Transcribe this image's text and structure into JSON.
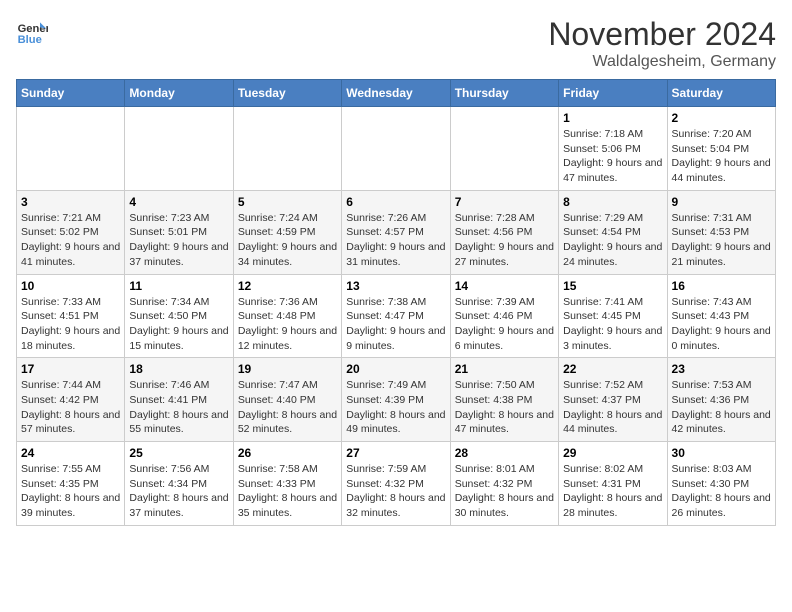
{
  "logo": {
    "line1": "General",
    "line2": "Blue"
  },
  "title": "November 2024",
  "location": "Waldalgesheim, Germany",
  "days_header": [
    "Sunday",
    "Monday",
    "Tuesday",
    "Wednesday",
    "Thursday",
    "Friday",
    "Saturday"
  ],
  "weeks": [
    [
      {
        "day": "",
        "info": ""
      },
      {
        "day": "",
        "info": ""
      },
      {
        "day": "",
        "info": ""
      },
      {
        "day": "",
        "info": ""
      },
      {
        "day": "",
        "info": ""
      },
      {
        "day": "1",
        "info": "Sunrise: 7:18 AM\nSunset: 5:06 PM\nDaylight: 9 hours and 47 minutes."
      },
      {
        "day": "2",
        "info": "Sunrise: 7:20 AM\nSunset: 5:04 PM\nDaylight: 9 hours and 44 minutes."
      }
    ],
    [
      {
        "day": "3",
        "info": "Sunrise: 7:21 AM\nSunset: 5:02 PM\nDaylight: 9 hours and 41 minutes."
      },
      {
        "day": "4",
        "info": "Sunrise: 7:23 AM\nSunset: 5:01 PM\nDaylight: 9 hours and 37 minutes."
      },
      {
        "day": "5",
        "info": "Sunrise: 7:24 AM\nSunset: 4:59 PM\nDaylight: 9 hours and 34 minutes."
      },
      {
        "day": "6",
        "info": "Sunrise: 7:26 AM\nSunset: 4:57 PM\nDaylight: 9 hours and 31 minutes."
      },
      {
        "day": "7",
        "info": "Sunrise: 7:28 AM\nSunset: 4:56 PM\nDaylight: 9 hours and 27 minutes."
      },
      {
        "day": "8",
        "info": "Sunrise: 7:29 AM\nSunset: 4:54 PM\nDaylight: 9 hours and 24 minutes."
      },
      {
        "day": "9",
        "info": "Sunrise: 7:31 AM\nSunset: 4:53 PM\nDaylight: 9 hours and 21 minutes."
      }
    ],
    [
      {
        "day": "10",
        "info": "Sunrise: 7:33 AM\nSunset: 4:51 PM\nDaylight: 9 hours and 18 minutes."
      },
      {
        "day": "11",
        "info": "Sunrise: 7:34 AM\nSunset: 4:50 PM\nDaylight: 9 hours and 15 minutes."
      },
      {
        "day": "12",
        "info": "Sunrise: 7:36 AM\nSunset: 4:48 PM\nDaylight: 9 hours and 12 minutes."
      },
      {
        "day": "13",
        "info": "Sunrise: 7:38 AM\nSunset: 4:47 PM\nDaylight: 9 hours and 9 minutes."
      },
      {
        "day": "14",
        "info": "Sunrise: 7:39 AM\nSunset: 4:46 PM\nDaylight: 9 hours and 6 minutes."
      },
      {
        "day": "15",
        "info": "Sunrise: 7:41 AM\nSunset: 4:45 PM\nDaylight: 9 hours and 3 minutes."
      },
      {
        "day": "16",
        "info": "Sunrise: 7:43 AM\nSunset: 4:43 PM\nDaylight: 9 hours and 0 minutes."
      }
    ],
    [
      {
        "day": "17",
        "info": "Sunrise: 7:44 AM\nSunset: 4:42 PM\nDaylight: 8 hours and 57 minutes."
      },
      {
        "day": "18",
        "info": "Sunrise: 7:46 AM\nSunset: 4:41 PM\nDaylight: 8 hours and 55 minutes."
      },
      {
        "day": "19",
        "info": "Sunrise: 7:47 AM\nSunset: 4:40 PM\nDaylight: 8 hours and 52 minutes."
      },
      {
        "day": "20",
        "info": "Sunrise: 7:49 AM\nSunset: 4:39 PM\nDaylight: 8 hours and 49 minutes."
      },
      {
        "day": "21",
        "info": "Sunrise: 7:50 AM\nSunset: 4:38 PM\nDaylight: 8 hours and 47 minutes."
      },
      {
        "day": "22",
        "info": "Sunrise: 7:52 AM\nSunset: 4:37 PM\nDaylight: 8 hours and 44 minutes."
      },
      {
        "day": "23",
        "info": "Sunrise: 7:53 AM\nSunset: 4:36 PM\nDaylight: 8 hours and 42 minutes."
      }
    ],
    [
      {
        "day": "24",
        "info": "Sunrise: 7:55 AM\nSunset: 4:35 PM\nDaylight: 8 hours and 39 minutes."
      },
      {
        "day": "25",
        "info": "Sunrise: 7:56 AM\nSunset: 4:34 PM\nDaylight: 8 hours and 37 minutes."
      },
      {
        "day": "26",
        "info": "Sunrise: 7:58 AM\nSunset: 4:33 PM\nDaylight: 8 hours and 35 minutes."
      },
      {
        "day": "27",
        "info": "Sunrise: 7:59 AM\nSunset: 4:32 PM\nDaylight: 8 hours and 32 minutes."
      },
      {
        "day": "28",
        "info": "Sunrise: 8:01 AM\nSunset: 4:32 PM\nDaylight: 8 hours and 30 minutes."
      },
      {
        "day": "29",
        "info": "Sunrise: 8:02 AM\nSunset: 4:31 PM\nDaylight: 8 hours and 28 minutes."
      },
      {
        "day": "30",
        "info": "Sunrise: 8:03 AM\nSunset: 4:30 PM\nDaylight: 8 hours and 26 minutes."
      }
    ]
  ]
}
